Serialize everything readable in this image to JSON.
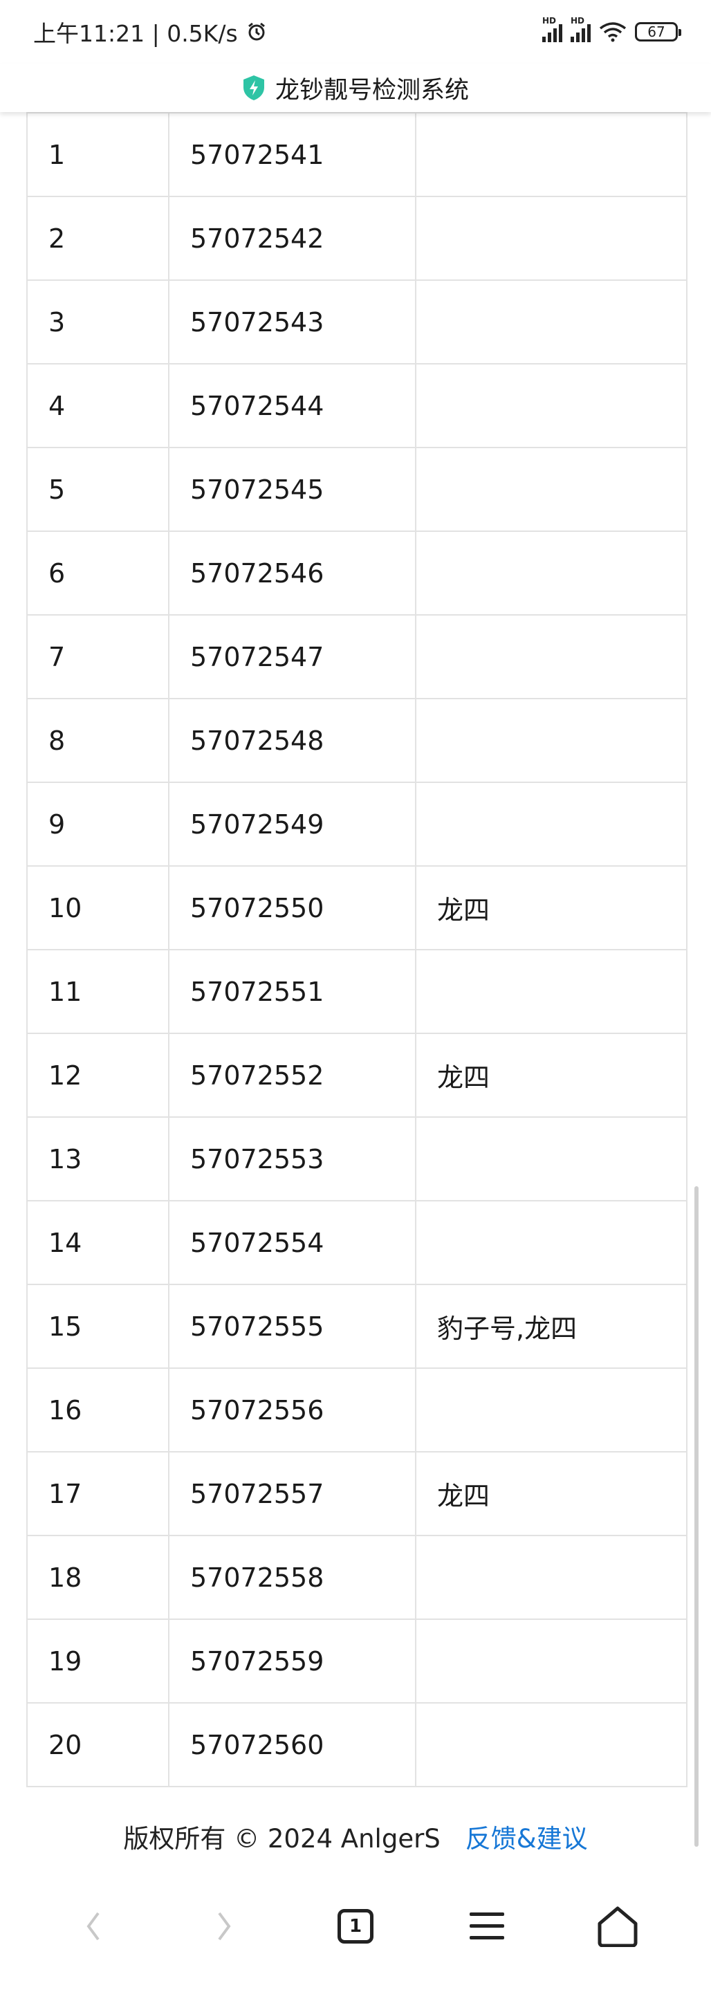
{
  "status_bar": {
    "time": "上午11:21 | 0.5K/s",
    "alarm_icon": "alarm-icon",
    "sim1_label": "HD",
    "sim2_label": "HD",
    "battery": "67"
  },
  "header": {
    "title": "龙钞靓号检测系统",
    "icon": "shield-bolt-icon"
  },
  "table": {
    "rows": [
      {
        "index": "1",
        "number": "57072541",
        "tag": ""
      },
      {
        "index": "2",
        "number": "57072542",
        "tag": ""
      },
      {
        "index": "3",
        "number": "57072543",
        "tag": ""
      },
      {
        "index": "4",
        "number": "57072544",
        "tag": ""
      },
      {
        "index": "5",
        "number": "57072545",
        "tag": ""
      },
      {
        "index": "6",
        "number": "57072546",
        "tag": ""
      },
      {
        "index": "7",
        "number": "57072547",
        "tag": ""
      },
      {
        "index": "8",
        "number": "57072548",
        "tag": ""
      },
      {
        "index": "9",
        "number": "57072549",
        "tag": ""
      },
      {
        "index": "10",
        "number": "57072550",
        "tag": "龙四"
      },
      {
        "index": "11",
        "number": "57072551",
        "tag": ""
      },
      {
        "index": "12",
        "number": "57072552",
        "tag": "龙四"
      },
      {
        "index": "13",
        "number": "57072553",
        "tag": ""
      },
      {
        "index": "14",
        "number": "57072554",
        "tag": ""
      },
      {
        "index": "15",
        "number": "57072555",
        "tag": "豹子号,龙四"
      },
      {
        "index": "16",
        "number": "57072556",
        "tag": ""
      },
      {
        "index": "17",
        "number": "57072557",
        "tag": "龙四"
      },
      {
        "index": "18",
        "number": "57072558",
        "tag": ""
      },
      {
        "index": "19",
        "number": "57072559",
        "tag": ""
      },
      {
        "index": "20",
        "number": "57072560",
        "tag": ""
      }
    ]
  },
  "footer": {
    "copyright": "版权所有 © 2024 AnlgerS",
    "feedback_link": "反馈&建议"
  },
  "bottom_nav": {
    "tab_count": "1",
    "icons": [
      "back-icon",
      "forward-icon",
      "tabs-icon",
      "menu-icon",
      "home-icon"
    ]
  },
  "colors": {
    "link": "#1677d6",
    "shield": "#2ec4a5",
    "border": "#e2e2e2"
  }
}
